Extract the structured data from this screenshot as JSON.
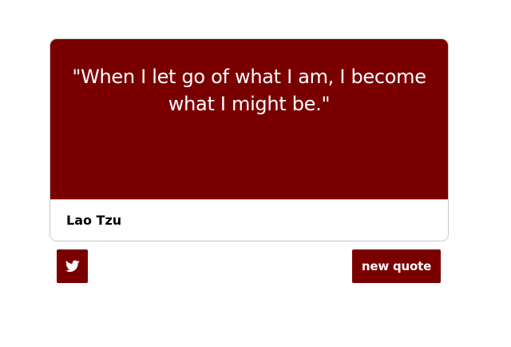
{
  "quote": {
    "text": "\"When I let go of what I am, I become what I might be.\"",
    "author": "Lao Tzu"
  },
  "actions": {
    "tweet_icon": "twitter-bird-icon",
    "new_quote_label": "new quote"
  },
  "colors": {
    "accent": "#7a0000",
    "quote_text": "#ffffff",
    "author_text": "#000000",
    "card_border": "#c9c9c9"
  }
}
